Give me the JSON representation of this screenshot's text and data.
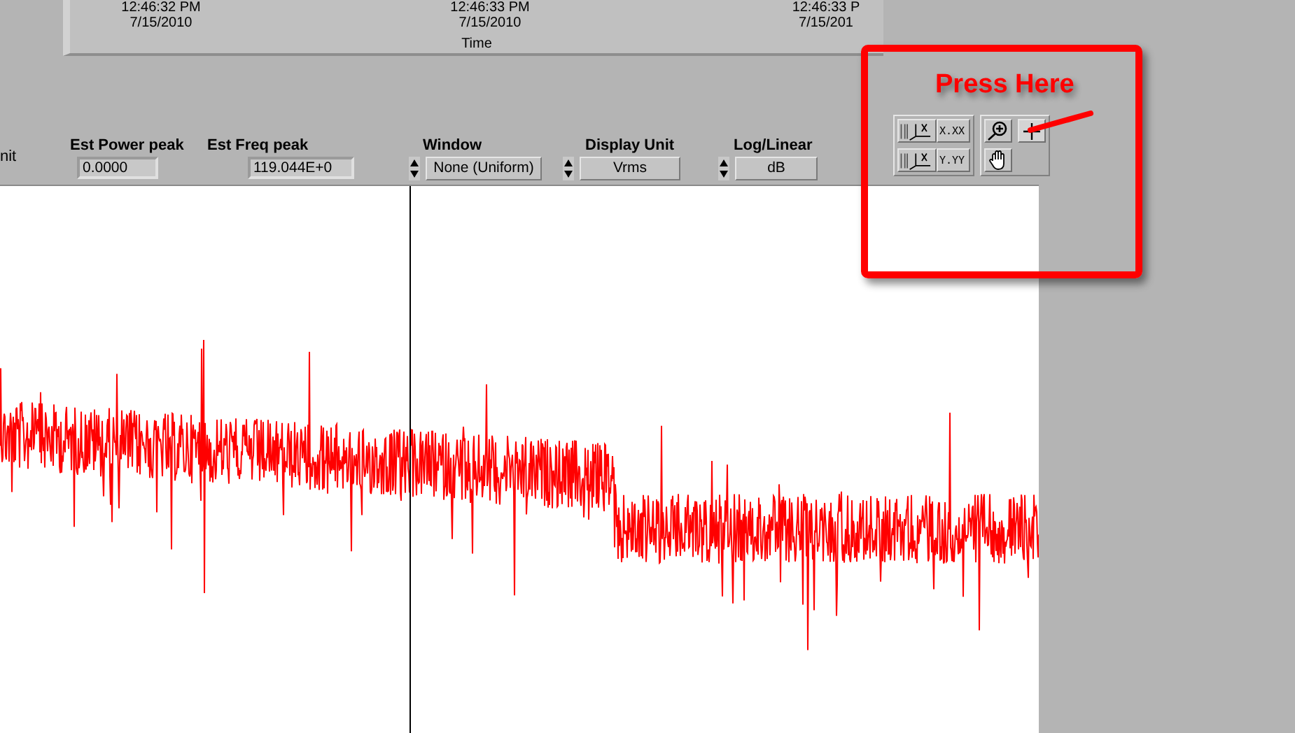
{
  "time_axis": {
    "ticks": [
      {
        "time": "12:46:32 PM",
        "date": "7/15/2010"
      },
      {
        "time": "12:46:33 PM",
        "date": "7/15/2010"
      },
      {
        "time": "12:46:33 P",
        "date": "7/15/201"
      }
    ],
    "title": "Time"
  },
  "controls": {
    "cut_label": "nit",
    "indicators": [
      {
        "label": "Est Power peak",
        "value": "0.0000"
      },
      {
        "label": "Est Freq peak",
        "value": "119.044E+0"
      }
    ],
    "rings": [
      {
        "label": "Window",
        "value": "None (Uniform)"
      },
      {
        "label": "Display Unit",
        "value": "Vrms"
      },
      {
        "label": "Log/Linear",
        "value": "dB"
      }
    ]
  },
  "graph_palette": {
    "x_format": "X.XX",
    "y_format": "Y.YY"
  },
  "annotation": {
    "text": "Press Here"
  }
}
